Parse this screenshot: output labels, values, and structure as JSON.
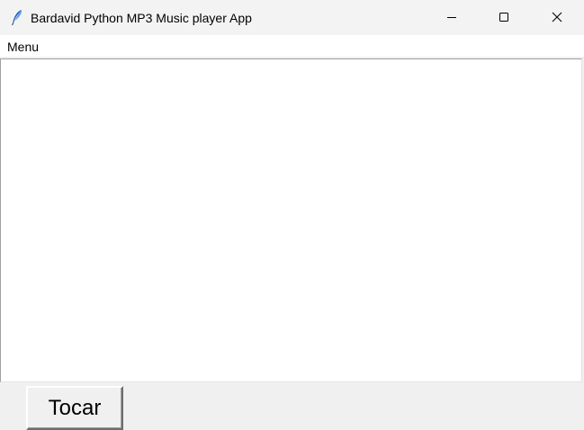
{
  "window": {
    "title": "Bardavid Python MP3 Music player App",
    "icon": "feather-icon",
    "controls": {
      "minimize_icon": "minimize-icon",
      "maximize_icon": "maximize-icon",
      "close_icon": "close-icon"
    }
  },
  "menubar": {
    "items": [
      {
        "label": "Menu"
      }
    ]
  },
  "playlist": {
    "items": []
  },
  "controls": {
    "play_label": "Tocar"
  },
  "colors": {
    "titlebar_bg": "#f3f3f3",
    "window_bg": "#f0f0f0",
    "listbox_bg": "#ffffff"
  }
}
